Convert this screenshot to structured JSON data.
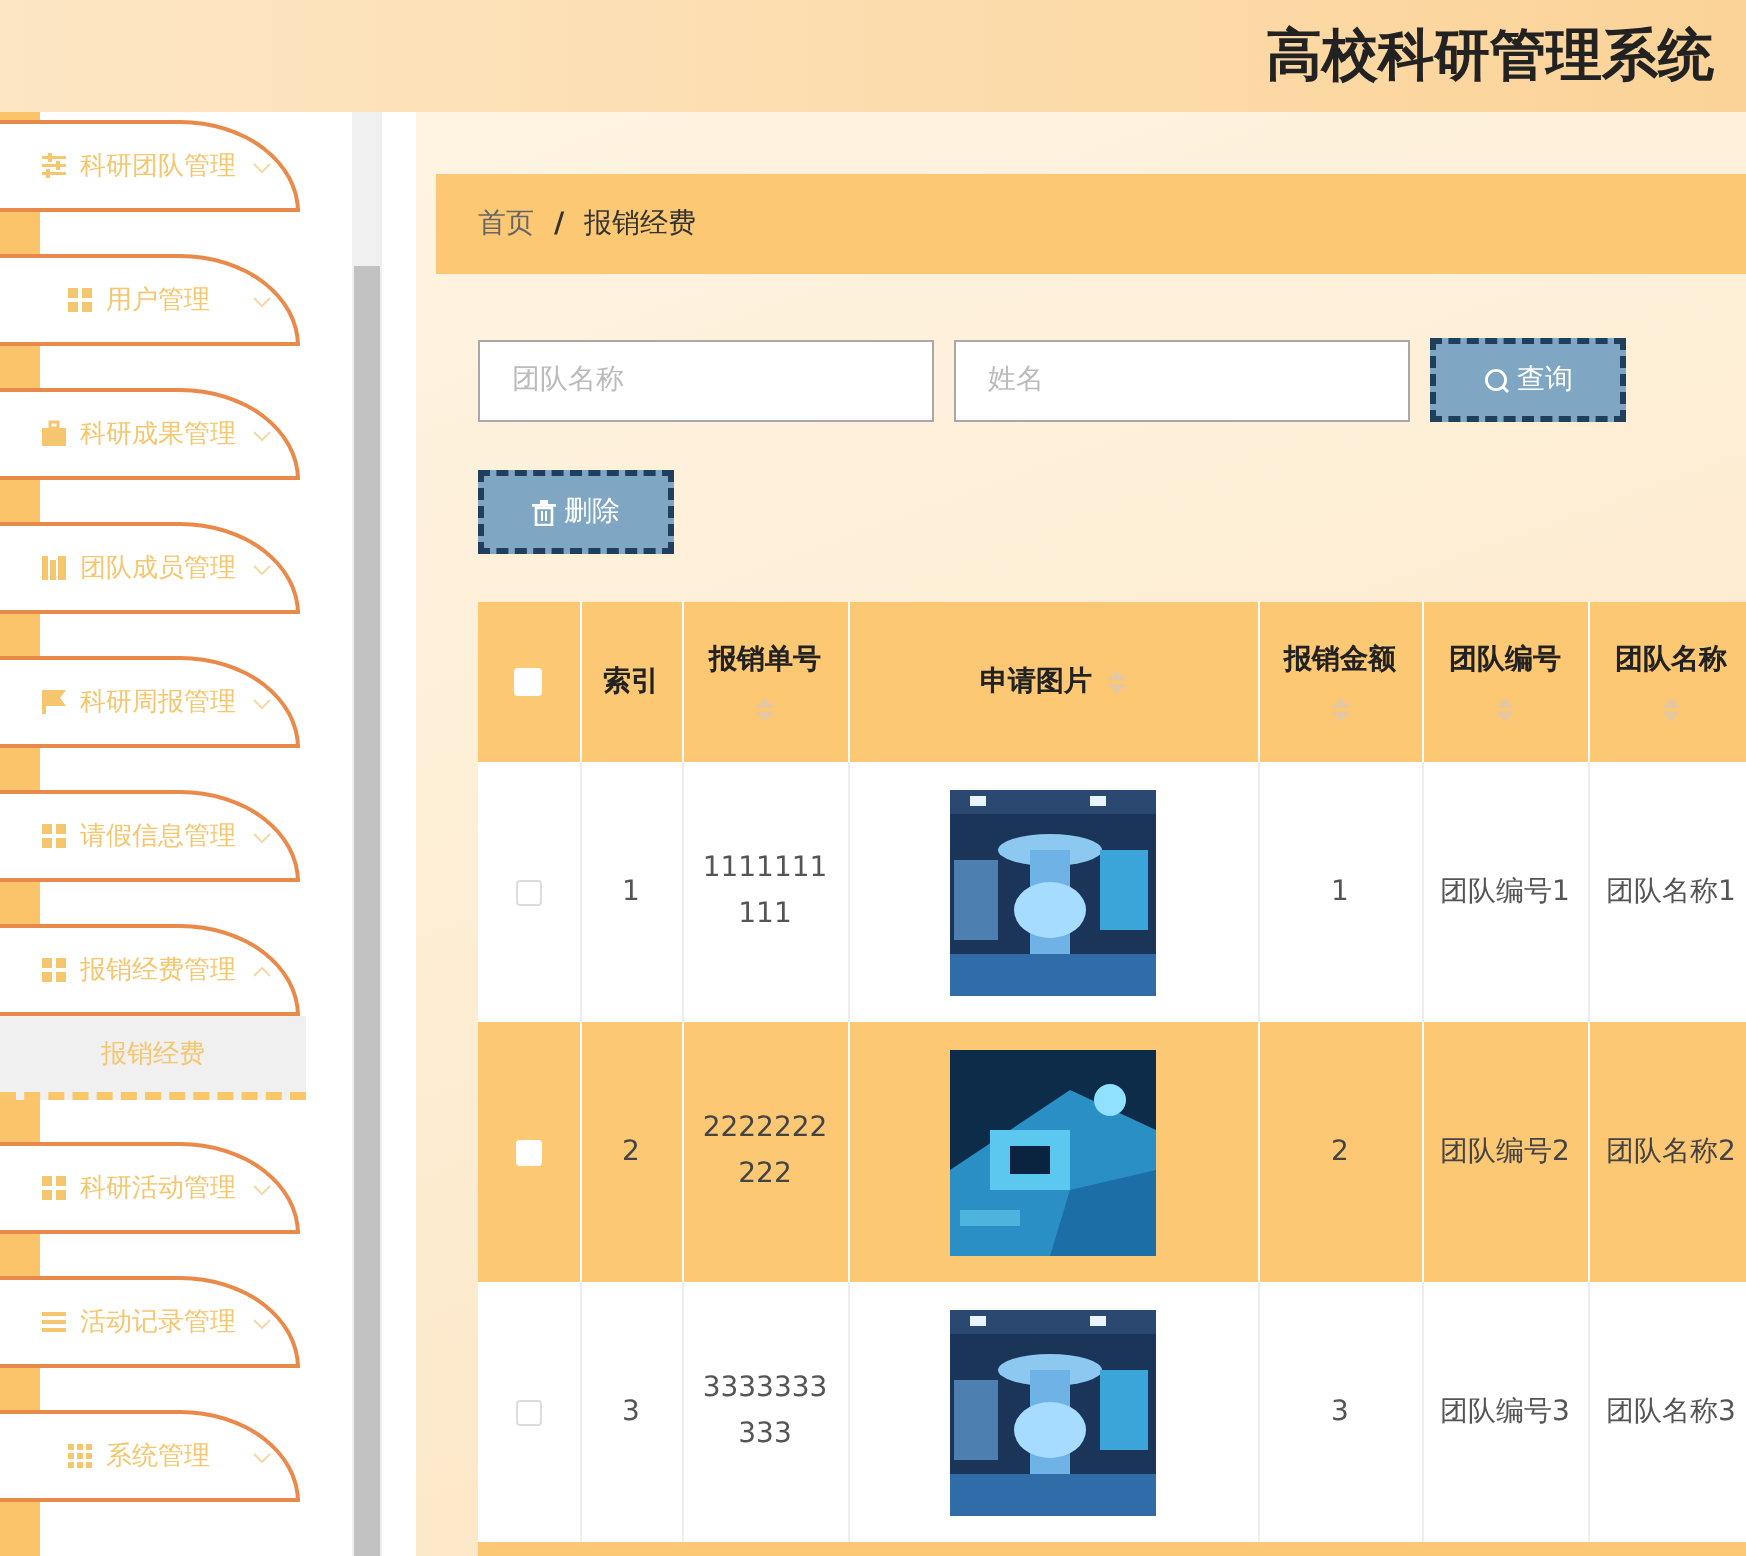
{
  "header": {
    "title": "高校科研管理系统"
  },
  "sidebar": {
    "items": [
      {
        "label": "科研团队管理",
        "expanded": false
      },
      {
        "label": "用户管理",
        "expanded": false
      },
      {
        "label": "科研成果管理",
        "expanded": false
      },
      {
        "label": "团队成员管理",
        "expanded": false
      },
      {
        "label": "科研周报管理",
        "expanded": false
      },
      {
        "label": "请假信息管理",
        "expanded": false
      },
      {
        "label": "报销经费管理",
        "expanded": true,
        "children": [
          {
            "label": "报销经费"
          }
        ]
      },
      {
        "label": "科研活动管理",
        "expanded": false
      },
      {
        "label": "活动记录管理",
        "expanded": false
      },
      {
        "label": "系统管理",
        "expanded": false
      }
    ]
  },
  "breadcrumb": {
    "items": [
      "首页",
      "报销经费"
    ],
    "separator": "/"
  },
  "search": {
    "fields": [
      {
        "placeholder": "团队名称"
      },
      {
        "placeholder": "姓名"
      }
    ],
    "button": "查询"
  },
  "actions": [
    "删除"
  ],
  "table": {
    "select_all": {
      "checked": false
    },
    "columns": [
      {
        "label": "索引",
        "sortable": false
      },
      {
        "label": "报销单号",
        "sortable": true
      },
      {
        "label": "申请图片",
        "sortable": true
      },
      {
        "label": "报销金额",
        "sortable": true
      },
      {
        "label": "团队编号",
        "sortable": true
      },
      {
        "label": "团队名称",
        "sortable": true
      }
    ],
    "rows": [
      {
        "selected": false,
        "cells": [
          "1",
          "1111111111",
          {
            "kind": "picture"
          },
          "1",
          "团队编号1",
          "团队名称1"
        ]
      },
      {
        "selected": false,
        "cells": [
          "2",
          "2222222222",
          {
            "kind": "picture"
          },
          "2",
          "团队编号2",
          "团队名称2"
        ]
      },
      {
        "selected": false,
        "cells": [
          "3",
          "3333333333",
          {
            "kind": "picture"
          },
          "3",
          "团队编号3",
          "团队名称3"
        ]
      }
    ]
  }
}
